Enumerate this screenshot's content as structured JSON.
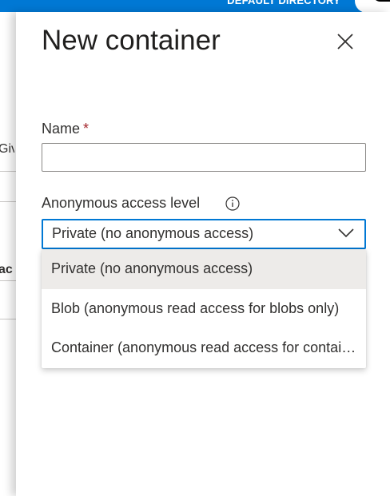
{
  "topbar": {
    "directory_label": "DEFAULT DIRECTORY"
  },
  "background_blade": {
    "fragments": [
      "Give",
      "ac"
    ]
  },
  "panel": {
    "title": "New container",
    "name_field": {
      "label": "Name",
      "required_marker": "*",
      "value": ""
    },
    "access_level": {
      "label": "Anonymous access level",
      "selected_value": "Private (no anonymous access)",
      "options": [
        "Private (no anonymous access)",
        "Blob (anonymous read access for blobs only)",
        "Container (anonymous read access for containers and blobs)"
      ]
    }
  },
  "colors": {
    "accent": "#0078d4",
    "required": "#a4262c",
    "selected_option_bg": "#edebe9"
  },
  "icons": [
    "close-icon",
    "info-icon",
    "chevron-down-icon"
  ]
}
